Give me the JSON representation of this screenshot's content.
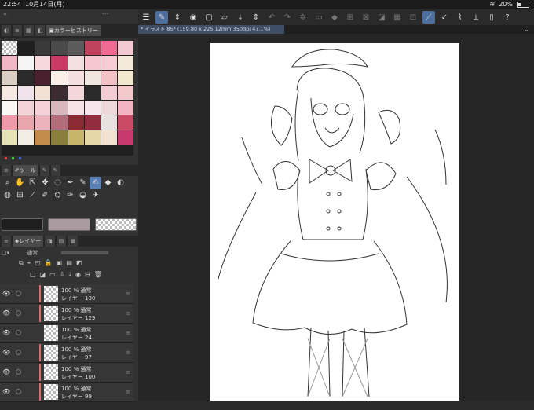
{
  "status": {
    "time": "22:54",
    "date": "10月14日(月)",
    "battery": "20%"
  },
  "color_panel": {
    "tab_label": "カラーヒストリー",
    "swatches": [
      "checker",
      "#1f1f1f",
      "#3a3a3a",
      "#4a4a4a",
      "#5b5b5b",
      "#c0435e",
      "#f06a95",
      "#f5c9d3",
      "#f2b7c6",
      "#f5f5f5",
      "#f6d9dc",
      "#c83a64",
      "#f3e0e0",
      "#f6c7cf",
      "#f8ccd5",
      "#f3eada",
      "#d9cfc3",
      "#2a2a2a",
      "#4a1f2d",
      "#fbefe9",
      "#f4dede",
      "#f0e6e0",
      "#f3c2c7",
      "#f2e7cf",
      "#f6e9e2",
      "#f0e3ea",
      "#f2e2d6",
      "#3d2b32",
      "#f4d7d9",
      "#2a2a2a",
      "#f2cdd3",
      "#f3c9cb",
      "#faf7f7",
      "#f3d3d7",
      "#f7d1d8",
      "#d9b7bd",
      "#f7e3e7",
      "#f6e5ea",
      "#f0d8da",
      "#f3b3c0",
      "#ee9aa9",
      "#e8a5ab",
      "#ebb3bb",
      "#b36c79",
      "#8c2a33",
      "#922c3e",
      "#e9e1df",
      "#c94b66",
      "#e7e3b8",
      "#f2ede4",
      "#c48c4c",
      "#8a7e3c",
      "#c6b56a",
      "#e6d7a8",
      "#f4e2d0",
      "#c63a70"
    ]
  },
  "tool_panel": {
    "tab_label": "ツール",
    "tools": [
      "magnifier-icon",
      "hand-icon",
      "pointer-icon",
      "move-icon",
      "lasso-icon",
      "pen-icon",
      "pencil-icon",
      "brush-icon",
      "eraser-icon",
      "fill-icon",
      "blur-icon",
      "grid-icon",
      "eyedropper-icon",
      "pen-fine-icon",
      "stamp-icon",
      "marker-icon",
      "blend-icon",
      "airbrush-icon"
    ]
  },
  "color_boxes": [
    "#1e1e1e",
    "#a99a9f",
    "checker"
  ],
  "layer_panel": {
    "tab_label": "レイヤー",
    "blend_mode": "通常",
    "layers": [
      {
        "line1": "100 % 通常",
        "line2": "レイヤー 130",
        "marked": true
      },
      {
        "line1": "100 % 通常",
        "line2": "レイヤー 129",
        "marked": true
      },
      {
        "line1": "100 % 通常",
        "line2": "レイヤー 24",
        "marked": false
      },
      {
        "line1": "100 % 通常",
        "line2": "レイヤー 97",
        "marked": true
      },
      {
        "line1": "100 % 通常",
        "line2": "レイヤー 100",
        "marked": true
      },
      {
        "line1": "100 % 通常",
        "line2": "レイヤー 99",
        "marked": true
      }
    ]
  },
  "document": {
    "tab_label": "* イラスト 85* (159.80 x 225.12mm 350dpi 47.1%)"
  }
}
